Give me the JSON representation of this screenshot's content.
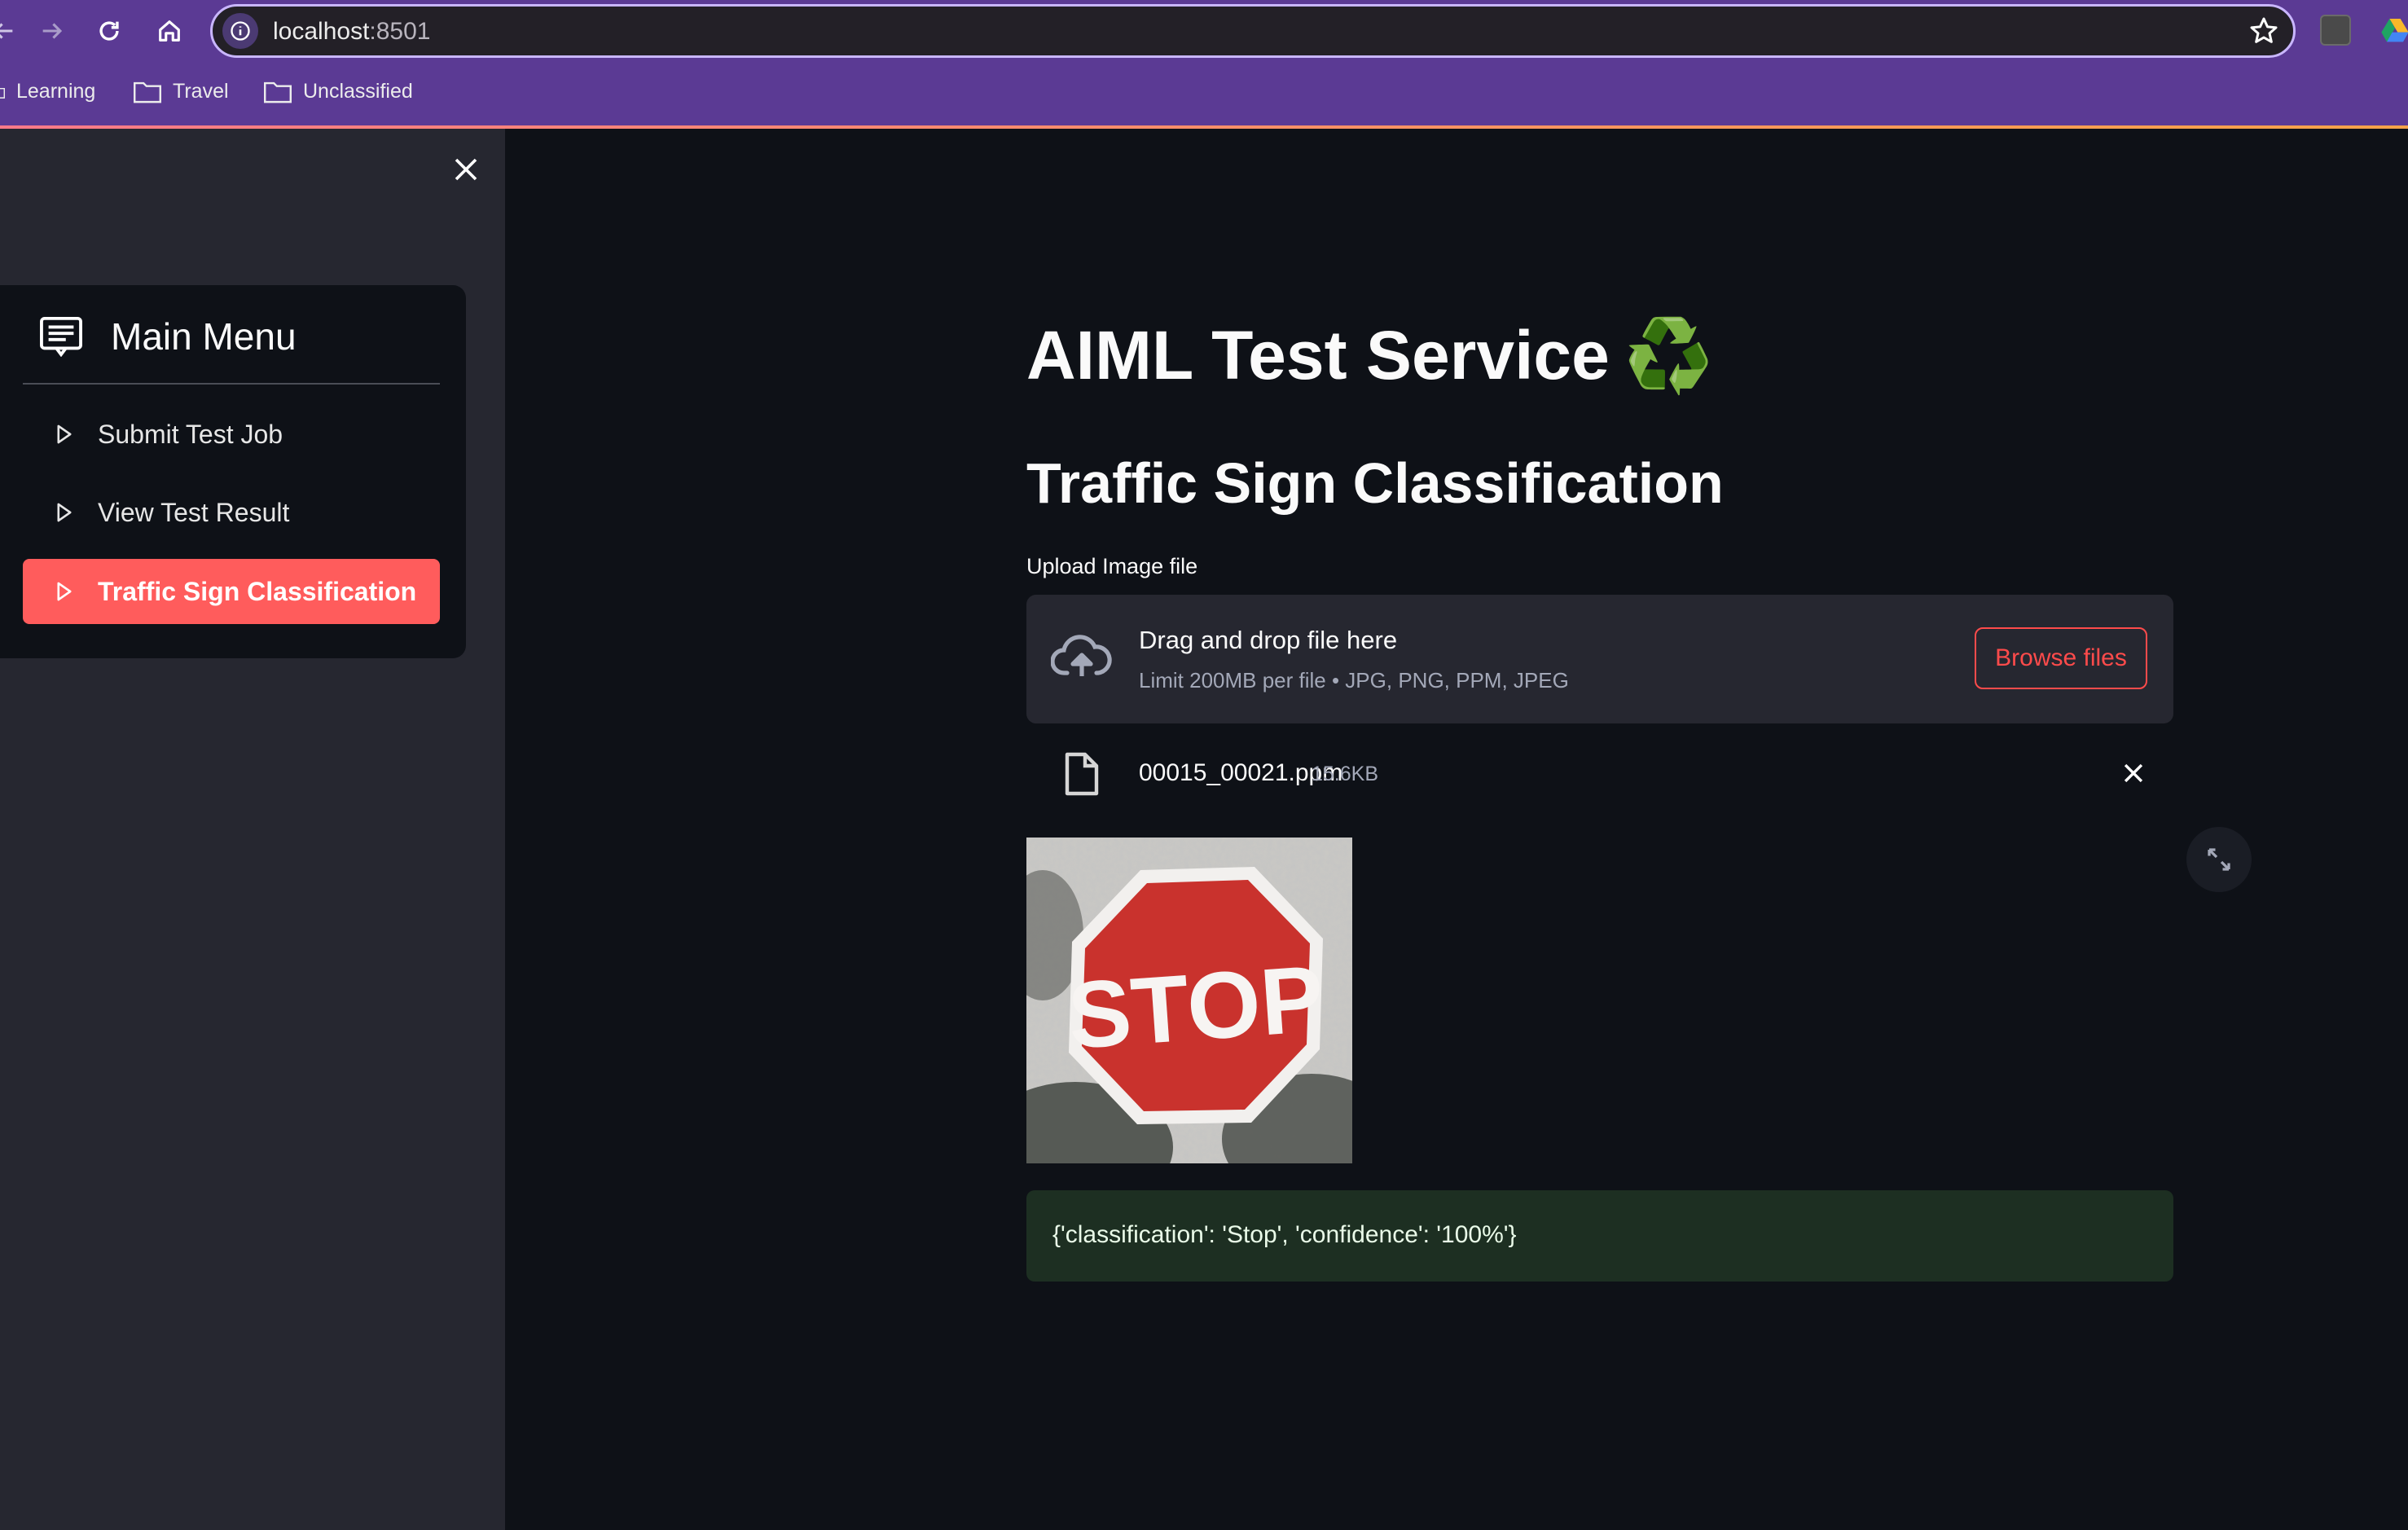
{
  "browser": {
    "url_host": "localhost",
    "url_port": ":8501",
    "bookmarks": [
      "Learning",
      "Travel",
      "Unclassified"
    ],
    "icons": [
      "back-icon",
      "forward-icon",
      "reload-icon",
      "home-icon",
      "site-info-icon",
      "star-icon",
      "folder-icon"
    ]
  },
  "sidebar": {
    "menu_title": "Main Menu",
    "items": [
      {
        "label": "Submit Test Job",
        "active": false
      },
      {
        "label": "View Test Result",
        "active": false
      },
      {
        "label": "Traffic Sign Classification",
        "active": true
      }
    ],
    "accent_color": "#ff5c5c"
  },
  "main": {
    "title": "AIML Test Service",
    "title_emoji": "♻️",
    "subtitle": "Traffic Sign Classification",
    "upload": {
      "label": "Upload Image file",
      "drop_text": "Drag and drop file here",
      "limit_text": "Limit 200MB per file • JPG, PNG, PPM, JPEG",
      "browse_label": "Browse files"
    },
    "file": {
      "name": "00015_00021.ppm",
      "size": "15.6KB"
    },
    "preview_sign_text": "STOP",
    "result": "{'classification': 'Stop', 'confidence': '100%'}"
  },
  "colors": {
    "app_background": "#0e1117",
    "sidebar_background": "#262730",
    "chrome_purple": "#5b3a94",
    "primary": "#ff4b4b",
    "success_background": "#1d2f22"
  }
}
